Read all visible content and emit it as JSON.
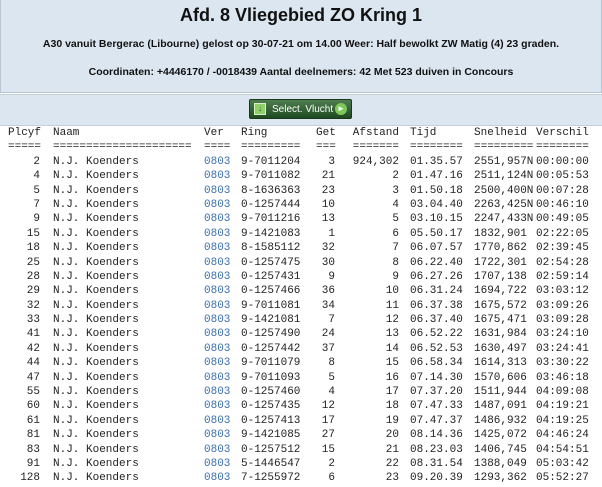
{
  "header": {
    "title": "Afd. 8 Vliegebied ZO Kring 1",
    "info_line": "A30 vanuit Bergerac (Libourne) gelost op 30-07-21 om 14.00 Weer: Half bewolkt ZW Matig (4) 23 graden.",
    "coord_line": "Coordinaten: +4446170 / -0018439 Aantal deelnemers: 42 Met 523 duiven in Concours"
  },
  "toolbar": {
    "select_label": "Select. Vlucht"
  },
  "table": {
    "headers": {
      "plcyf": "Plcyf",
      "naam": "Naam",
      "ver": "Ver",
      "ring": "Ring",
      "get": "Get",
      "afstand": "Afstand",
      "tijd": "Tijd",
      "snelheid": "Snelheid",
      "verschil": "Verschil"
    },
    "separators": {
      "plcyf": "=====",
      "naam": "=====================",
      "ver": "====",
      "ring": "=========",
      "get": "===",
      "afstand": "=======",
      "tijd": "========",
      "snelheid": "=========",
      "verschil": "========"
    },
    "rows": [
      {
        "plcyf": "2",
        "naam": "N.J. Koenders",
        "ver": "0803",
        "ring": "9-7011204",
        "get": "3",
        "afstand": "924,302",
        "tijd": "01.35.57",
        "snelheid": "2551,957N",
        "verschil": "00:00:00"
      },
      {
        "plcyf": "4",
        "naam": "N.J. Koenders",
        "ver": "0803",
        "ring": "9-7011082",
        "get": "21",
        "afstand": "2",
        "tijd": "01.47.16",
        "snelheid": "2511,124N",
        "verschil": "00:05:53"
      },
      {
        "plcyf": "5",
        "naam": "N.J. Koenders",
        "ver": "0803",
        "ring": "8-1636363",
        "get": "23",
        "afstand": "3",
        "tijd": "01.50.18",
        "snelheid": "2500,400N",
        "verschil": "00:07:28"
      },
      {
        "plcyf": "7",
        "naam": "N.J. Koenders",
        "ver": "0803",
        "ring": "0-1257444",
        "get": "10",
        "afstand": "4",
        "tijd": "03.04.40",
        "snelheid": "2263,425N",
        "verschil": "00:46:10"
      },
      {
        "plcyf": "9",
        "naam": "N.J. Koenders",
        "ver": "0803",
        "ring": "9-7011216",
        "get": "13",
        "afstand": "5",
        "tijd": "03.10.15",
        "snelheid": "2247,433N",
        "verschil": "00:49:05"
      },
      {
        "plcyf": "15",
        "naam": "N.J. Koenders",
        "ver": "0803",
        "ring": "9-1421083",
        "get": "1",
        "afstand": "6",
        "tijd": "05.50.17",
        "snelheid": "1832,901",
        "verschil": "02:22:05"
      },
      {
        "plcyf": "18",
        "naam": "N.J. Koenders",
        "ver": "0803",
        "ring": "8-1585112",
        "get": "32",
        "afstand": "7",
        "tijd": "06.07.57",
        "snelheid": "1770,862",
        "verschil": "02:39:45"
      },
      {
        "plcyf": "25",
        "naam": "N.J. Koenders",
        "ver": "0803",
        "ring": "0-1257475",
        "get": "30",
        "afstand": "8",
        "tijd": "06.22.40",
        "snelheid": "1722,301",
        "verschil": "02:54:28"
      },
      {
        "plcyf": "28",
        "naam": "N.J. Koenders",
        "ver": "0803",
        "ring": "0-1257431",
        "get": "9",
        "afstand": "9",
        "tijd": "06.27.26",
        "snelheid": "1707,138",
        "verschil": "02:59:14"
      },
      {
        "plcyf": "29",
        "naam": "N.J. Koenders",
        "ver": "0803",
        "ring": "0-1257466",
        "get": "36",
        "afstand": "10",
        "tijd": "06.31.24",
        "snelheid": "1694,722",
        "verschil": "03:03:12"
      },
      {
        "plcyf": "32",
        "naam": "N.J. Koenders",
        "ver": "0803",
        "ring": "9-7011081",
        "get": "34",
        "afstand": "11",
        "tijd": "06.37.38",
        "snelheid": "1675,572",
        "verschil": "03:09:26"
      },
      {
        "plcyf": "33",
        "naam": "N.J. Koenders",
        "ver": "0803",
        "ring": "9-1421081",
        "get": "7",
        "afstand": "12",
        "tijd": "06.37.40",
        "snelheid": "1675,471",
        "verschil": "03:09:28"
      },
      {
        "plcyf": "41",
        "naam": "N.J. Koenders",
        "ver": "0803",
        "ring": "0-1257490",
        "get": "24",
        "afstand": "13",
        "tijd": "06.52.22",
        "snelheid": "1631,984",
        "verschil": "03:24:10"
      },
      {
        "plcyf": "42",
        "naam": "N.J. Koenders",
        "ver": "0803",
        "ring": "0-1257442",
        "get": "37",
        "afstand": "14",
        "tijd": "06.52.53",
        "snelheid": "1630,497",
        "verschil": "03:24:41"
      },
      {
        "plcyf": "44",
        "naam": "N.J. Koenders",
        "ver": "0803",
        "ring": "9-7011079",
        "get": "8",
        "afstand": "15",
        "tijd": "06.58.34",
        "snelheid": "1614,313",
        "verschil": "03:30:22"
      },
      {
        "plcyf": "47",
        "naam": "N.J. Koenders",
        "ver": "0803",
        "ring": "9-7011093",
        "get": "5",
        "afstand": "16",
        "tijd": "07.14.30",
        "snelheid": "1570,606",
        "verschil": "03:46:18"
      },
      {
        "plcyf": "55",
        "naam": "N.J. Koenders",
        "ver": "0803",
        "ring": "0-1257460",
        "get": "4",
        "afstand": "17",
        "tijd": "07.37.20",
        "snelheid": "1511,944",
        "verschil": "04:09:08"
      },
      {
        "plcyf": "60",
        "naam": "N.J. Koenders",
        "ver": "0803",
        "ring": "0-1257435",
        "get": "12",
        "afstand": "18",
        "tijd": "07.47.33",
        "snelheid": "1487,091",
        "verschil": "04:19:21"
      },
      {
        "plcyf": "61",
        "naam": "N.J. Koenders",
        "ver": "0803",
        "ring": "0-1257413",
        "get": "17",
        "afstand": "19",
        "tijd": "07.47.37",
        "snelheid": "1486,932",
        "verschil": "04:19:25"
      },
      {
        "plcyf": "81",
        "naam": "N.J. Koenders",
        "ver": "0803",
        "ring": "9-1421085",
        "get": "27",
        "afstand": "20",
        "tijd": "08.14.36",
        "snelheid": "1425,072",
        "verschil": "04:46:24"
      },
      {
        "plcyf": "83",
        "naam": "N.J. Koenders",
        "ver": "0803",
        "ring": "0-1257512",
        "get": "15",
        "afstand": "21",
        "tijd": "08.23.03",
        "snelheid": "1406,745",
        "verschil": "04:54:51"
      },
      {
        "plcyf": "91",
        "naam": "N.J. Koenders",
        "ver": "0803",
        "ring": "5-1446547",
        "get": "2",
        "afstand": "22",
        "tijd": "08.31.54",
        "snelheid": "1388,049",
        "verschil": "05:03:42"
      },
      {
        "plcyf": "128",
        "naam": "N.J. Koenders",
        "ver": "0803",
        "ring": "7-1255972",
        "get": "6",
        "afstand": "23",
        "tijd": "09.20.39",
        "snelheid": "1293,362",
        "verschil": "05:52:27"
      }
    ]
  }
}
